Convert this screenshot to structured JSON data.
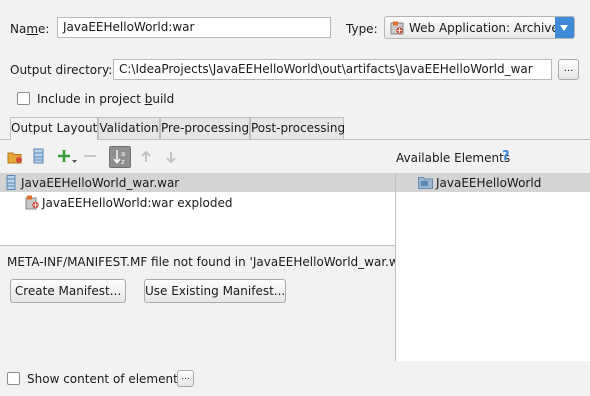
{
  "name": {
    "label_pre": "Na",
    "label_u": "m",
    "label_post": "e:",
    "value": "JavaEEHelloWorld:war"
  },
  "type": {
    "label": "Type:",
    "value": "Web Application: Archive"
  },
  "output_dir": {
    "label": "Output directory:",
    "value": "C:\\IdeaProjects\\JavaEEHelloWorld\\out\\artifacts\\JavaEEHelloWorld_war",
    "browse_label": "..."
  },
  "include_build": {
    "label_pre": "Include in project ",
    "label_u": "b",
    "label_post": "uild",
    "checked": false
  },
  "tabs": [
    {
      "label": "Output Layout",
      "active": true
    },
    {
      "label": "Validation",
      "active": false
    },
    {
      "label": "Pre-processing",
      "active": false
    },
    {
      "label": "Post-processing",
      "active": false
    }
  ],
  "available_title": "Available Elements",
  "help_glyph": "?",
  "tree": {
    "root": "JavaEEHelloWorld_war.war",
    "child": "JavaEEHelloWorld:war exploded"
  },
  "available": {
    "item": "JavaEEHelloWorld"
  },
  "manifest_msg": "META-INF/MANIFEST.MF file not found in 'JavaEEHelloWorld_war.war'",
  "create_manifest_label": "Create Manifest...",
  "use_manifest_label": "Use Existing Manifest...",
  "show_content": {
    "label": "Show content of elements",
    "checked": false,
    "more_label": "..."
  },
  "colors": {
    "accent": "#3f8ad8",
    "selection": "#d4d4d4",
    "green": "#3a9a3a",
    "help": "#3e8ad8"
  }
}
